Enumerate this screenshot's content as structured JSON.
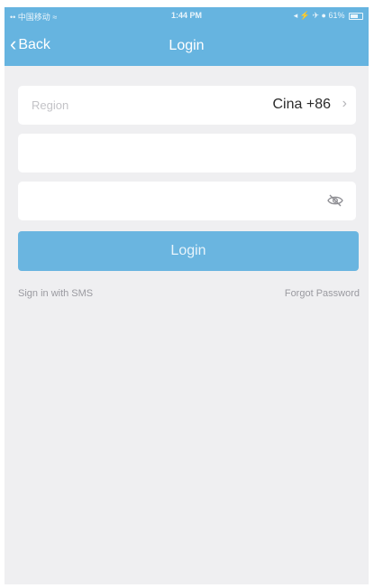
{
  "status_bar": {
    "carrier": "•• 中国移动",
    "wifi": "≈",
    "time": "1:44 PM",
    "indicators": "◂ ⚡ ✈ ●",
    "battery": "61%"
  },
  "nav": {
    "back_label": "Back",
    "title": "Login"
  },
  "form": {
    "region_label": "Region",
    "region_value": "Cina +86",
    "phone_placeholder": "",
    "password_placeholder": "",
    "login_label": "Login"
  },
  "links": {
    "sms": "Sign in with SMS",
    "forgot": "Forgot Password"
  },
  "icons": {
    "back": "chevron-left-icon",
    "region_chevron": "chevron-right-icon",
    "password_visibility": "eye-off-icon"
  },
  "colors": {
    "header": "#66b4e0",
    "login_button": "#6ab5e0",
    "background": "#efeff1"
  }
}
